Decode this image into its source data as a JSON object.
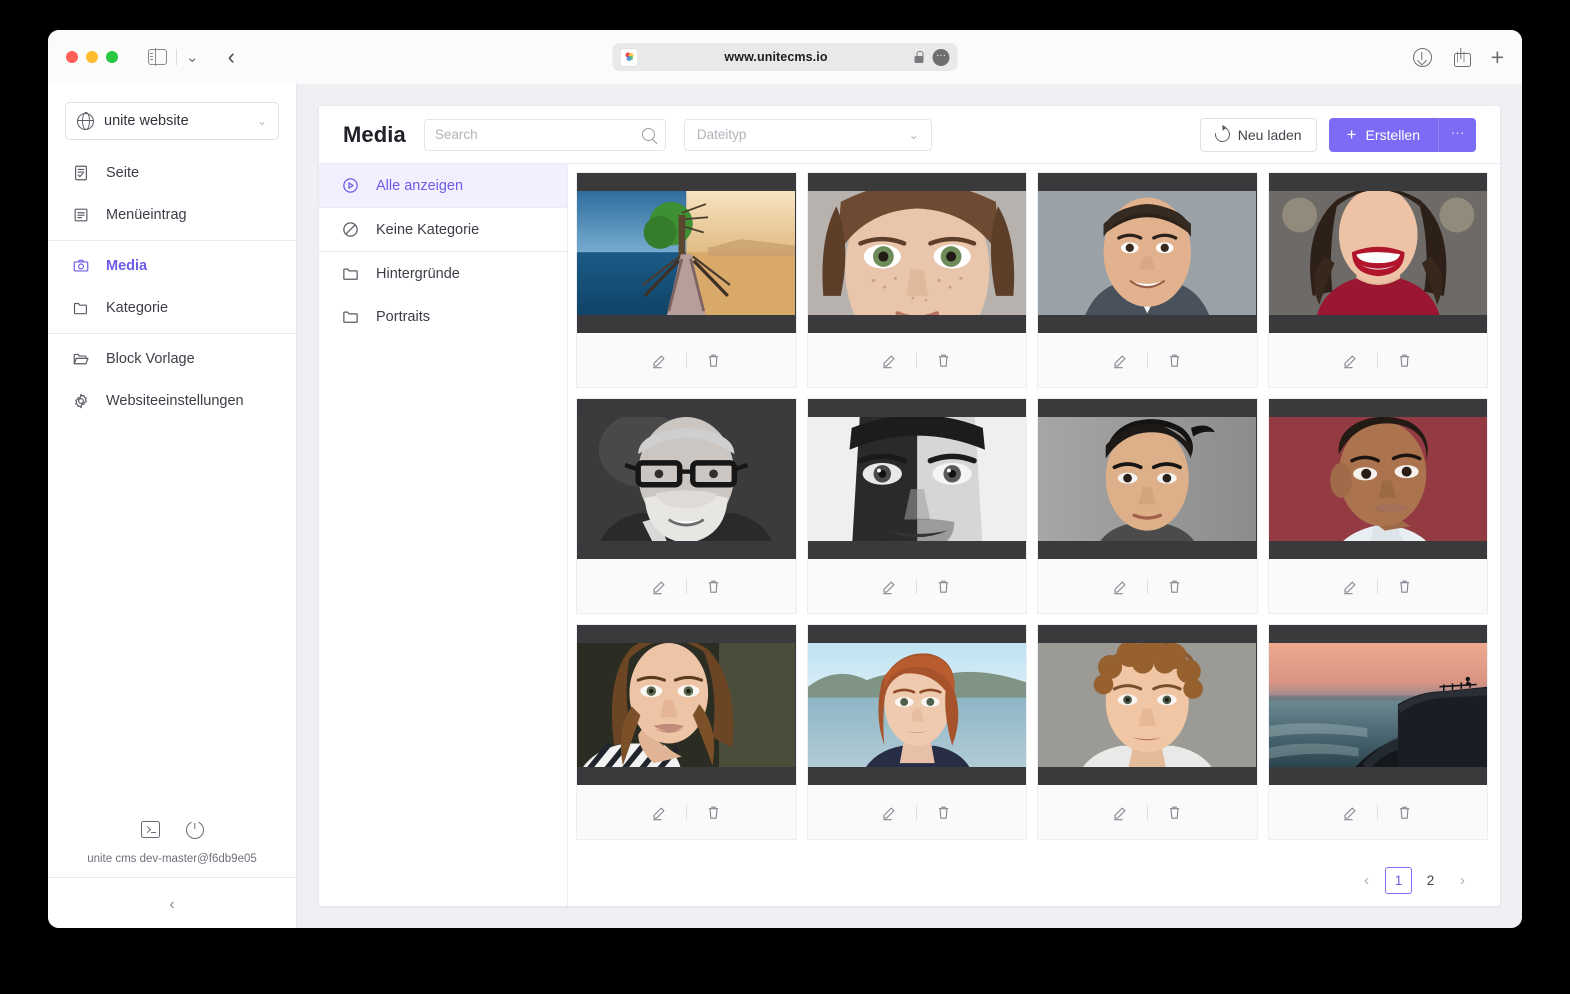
{
  "browser": {
    "url": "www.unitecms.io",
    "controls": {
      "close": "close-window",
      "minimize": "minimize-window",
      "maximize": "maximize-window"
    },
    "toolbar": {
      "sidebar_toggle": "sidebar-toggle-icon",
      "tab_overview": "chevron-down-icon",
      "back": "back-icon",
      "downloads": "download-icon",
      "share": "share-icon",
      "new_tab": "plus-icon",
      "lock": "lock-icon",
      "page_settings": "ellipsis-icon"
    }
  },
  "sidebar": {
    "site_selector": {
      "label": "unite website",
      "icon": "globe-icon",
      "chevron": "chevron-down-icon"
    },
    "items": [
      {
        "label": "Seite",
        "icon": "page-icon",
        "active": false
      },
      {
        "label": "Menüeintrag",
        "icon": "menu-entry-icon",
        "active": false
      },
      {
        "label": "Media",
        "icon": "camera-icon",
        "active": true
      },
      {
        "label": "Kategorie",
        "icon": "folder-icon",
        "active": false
      },
      {
        "label": "Block Vorlage",
        "icon": "open-folder-icon",
        "active": false
      },
      {
        "label": "Websiteeinstellungen",
        "icon": "gear-icon",
        "active": false
      }
    ],
    "footer": {
      "terminal_icon": "terminal-icon",
      "power_icon": "power-icon",
      "version": "unite cms dev-master@f6db9e05",
      "collapse_icon": "chevron-left-icon"
    }
  },
  "header": {
    "title": "Media",
    "search": {
      "value": "",
      "placeholder": "Search",
      "icon": "search-icon"
    },
    "filetype_select": {
      "value": "Dateityp",
      "chevron": "chevron-down-icon"
    },
    "reload_button": {
      "label": "Neu laden",
      "icon": "refresh-icon"
    },
    "create_button": {
      "label": "Erstellen",
      "icon": "plus-icon"
    },
    "more_button": {
      "label": "···"
    }
  },
  "categories": [
    {
      "label": "Alle anzeigen",
      "icon": "play-circle-icon",
      "active": true
    },
    {
      "label": "Keine Kategorie",
      "icon": "no-category-icon",
      "active": false
    },
    {
      "label": "Hintergründe",
      "icon": "folder-icon",
      "active": false
    },
    {
      "label": "Portraits",
      "icon": "folder-icon",
      "active": false
    }
  ],
  "media_items": [
    {
      "id": 1,
      "art": "split-tree-bridge",
      "edit_icon": "pencil-icon",
      "delete_icon": "trash-icon"
    },
    {
      "id": 2,
      "art": "freckled-woman",
      "edit_icon": "pencil-icon",
      "delete_icon": "trash-icon"
    },
    {
      "id": 3,
      "art": "smiling-man-grey",
      "edit_icon": "pencil-icon",
      "delete_icon": "trash-icon"
    },
    {
      "id": 4,
      "art": "red-sweater-woman",
      "edit_icon": "pencil-icon",
      "delete_icon": "trash-icon"
    },
    {
      "id": 5,
      "art": "bearded-glasses-bw",
      "edit_icon": "pencil-icon",
      "delete_icon": "trash-icon"
    },
    {
      "id": 6,
      "art": "closeup-face-bw",
      "edit_icon": "pencil-icon",
      "delete_icon": "trash-icon"
    },
    {
      "id": 7,
      "art": "young-man-grey",
      "edit_icon": "pencil-icon",
      "delete_icon": "trash-icon"
    },
    {
      "id": 8,
      "art": "woman-red-wall",
      "edit_icon": "pencil-icon",
      "delete_icon": "trash-icon"
    },
    {
      "id": 9,
      "art": "striped-shirt-woman",
      "edit_icon": "pencil-icon",
      "delete_icon": "trash-icon"
    },
    {
      "id": 10,
      "art": "redhead-lake",
      "edit_icon": "pencil-icon",
      "delete_icon": "trash-icon"
    },
    {
      "id": 11,
      "art": "curly-hair-man",
      "edit_icon": "pencil-icon",
      "delete_icon": "trash-icon"
    },
    {
      "id": 12,
      "art": "sunset-cliff",
      "edit_icon": "pencil-icon",
      "delete_icon": "trash-icon"
    }
  ],
  "pagination": {
    "prev": "‹",
    "pages": [
      "1",
      "2"
    ],
    "current": "1",
    "next": "›"
  },
  "colors": {
    "accent": "#7c6cf5",
    "accent_text": "#6c5ce7",
    "accent_bg": "#f2effe",
    "app_bg": "#eff0f4",
    "thumb_bg": "#3a3a3c"
  }
}
